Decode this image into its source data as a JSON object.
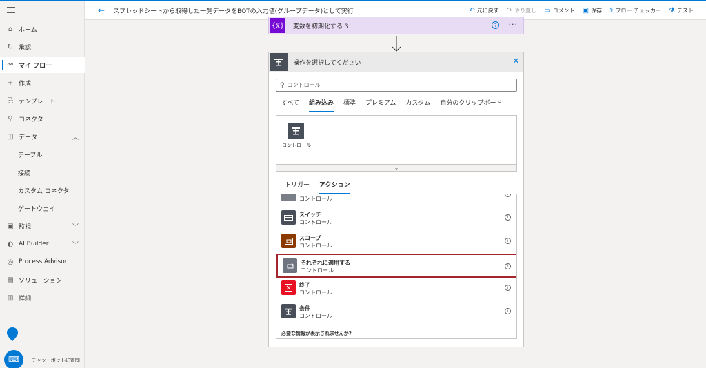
{
  "app": {
    "accent": "#0078d4"
  },
  "sidebar": {
    "items": [
      {
        "label": "ホーム",
        "icon": "home-icon"
      },
      {
        "label": "承認",
        "icon": "approvals-icon"
      },
      {
        "label": "マイ フロー",
        "icon": "flow-icon",
        "active": true
      },
      {
        "label": "作成",
        "icon": "plus-icon"
      },
      {
        "label": "テンプレート",
        "icon": "template-icon"
      },
      {
        "label": "コネクタ",
        "icon": "connector-icon"
      },
      {
        "label": "データ",
        "icon": "data-icon",
        "expanded": true
      },
      {
        "label": "テーブル"
      },
      {
        "label": "接続"
      },
      {
        "label": "カスタム コネクタ"
      },
      {
        "label": "ゲートウェイ"
      },
      {
        "label": "監視",
        "icon": "monitor-icon"
      },
      {
        "label": "AI Builder",
        "icon": "ai-builder-icon"
      },
      {
        "label": "Process Advisor",
        "icon": "process-advisor-icon"
      },
      {
        "label": "ソリューション",
        "icon": "solutions-icon"
      },
      {
        "label": "詳細",
        "icon": "learn-icon"
      }
    ],
    "chatbot_label": "チャットボットに質問"
  },
  "header": {
    "flow_title": "スプレッドシートから取得した一覧データをBOTの入力値(グループデータ)として実行",
    "toolbar": {
      "undo": "元に戻す",
      "redo": "やり直し",
      "comment": "コメント",
      "save": "保存",
      "checker": "フロー チェッカー",
      "test": "テスト"
    }
  },
  "variable_card": {
    "icon_text": "{x}",
    "title": "変数を初期化する 3",
    "color": "#770bd6"
  },
  "panel": {
    "title": "操作を選択してください",
    "search_placeholder": "コントロール",
    "tabs": [
      "すべて",
      "組み込み",
      "標準",
      "プレミアム",
      "カスタム",
      "自分のクリップボード"
    ],
    "selected_tab": "組み込み",
    "connector": {
      "label": "コントロール"
    },
    "subtabs": [
      "トリガー",
      "アクション"
    ],
    "selected_subtab": "アクション",
    "actions": [
      {
        "name": "",
        "category": "コントロール",
        "color": "#7a7f87"
      },
      {
        "name": "スイッチ",
        "category": "コントロール",
        "color": "#484f58"
      },
      {
        "name": "スコープ",
        "category": "コントロール",
        "color": "#8c3900"
      },
      {
        "name": "それぞれに適用する",
        "category": "コントロール",
        "color": "#6e7580",
        "highlighted": true
      },
      {
        "name": "終了",
        "category": "コントロール",
        "color": "#e81123"
      },
      {
        "name": "条件",
        "category": "コントロール",
        "color": "#484f58"
      }
    ],
    "missing_text": "必要な情報が表示されませんか?"
  }
}
